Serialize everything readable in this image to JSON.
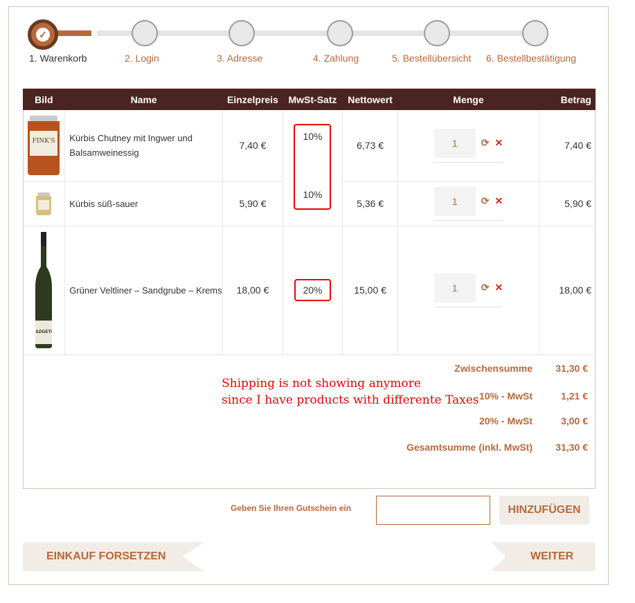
{
  "steps": [
    {
      "label": "1. Warenkorb",
      "active": true
    },
    {
      "label": "2. Login"
    },
    {
      "label": "3. Adresse"
    },
    {
      "label": "4. Zahlung"
    },
    {
      "label": "5. Bestellübersicht"
    },
    {
      "label": "6. Bestellbestätigung"
    }
  ],
  "table": {
    "headers": {
      "image": "Bild",
      "name": "Name",
      "unit_price": "Einzelpreis",
      "tax_rate": "MwSt-Satz",
      "net": "Nettowert",
      "qty": "Menge",
      "amount": "Betrag"
    },
    "rows": [
      {
        "name": "Kürbis Chutney mit Ingwer und Balsamweinessig",
        "unit_price": "7,40 €",
        "tax_rate": "10%",
        "net": "6,73 €",
        "qty": "1",
        "amount": "7,40 €",
        "image_label": "FINK'S"
      },
      {
        "name": "Kürbis süß-sauer",
        "unit_price": "5,90 €",
        "tax_rate": "10%",
        "net": "5,36 €",
        "qty": "1",
        "amount": "5,90 €"
      },
      {
        "name": "Grüner Veltliner – Sandgrube – Krems",
        "unit_price": "18,00 €",
        "tax_rate": "20%",
        "net": "15,00 €",
        "qty": "1",
        "amount": "18,00 €",
        "image_label": "SZIGETI"
      }
    ]
  },
  "totals": {
    "subtotal_label": "Zwischensumme",
    "subtotal": "31,30 €",
    "tax10_label": "10% - MwSt",
    "tax10": "1,21 €",
    "tax20_label": "20% - MwSt",
    "tax20": "3,00 €",
    "grand_label": "Gesamtsumme (inkl. MwSt)",
    "grand": "31,30 €"
  },
  "annotation": "Shipping is not showing anymore\nsince I have products with differente Taxes",
  "coupon": {
    "label": "Geben Sie Ihren Gutschein ein",
    "value": "",
    "button": "HINZUFÜGEN"
  },
  "buttons": {
    "continue": "EINKAUF FORSETZEN",
    "next": "WEITER"
  },
  "colors": {
    "accent": "#b8683a",
    "header_bg": "#4a2420",
    "annotation": "#e00000"
  }
}
